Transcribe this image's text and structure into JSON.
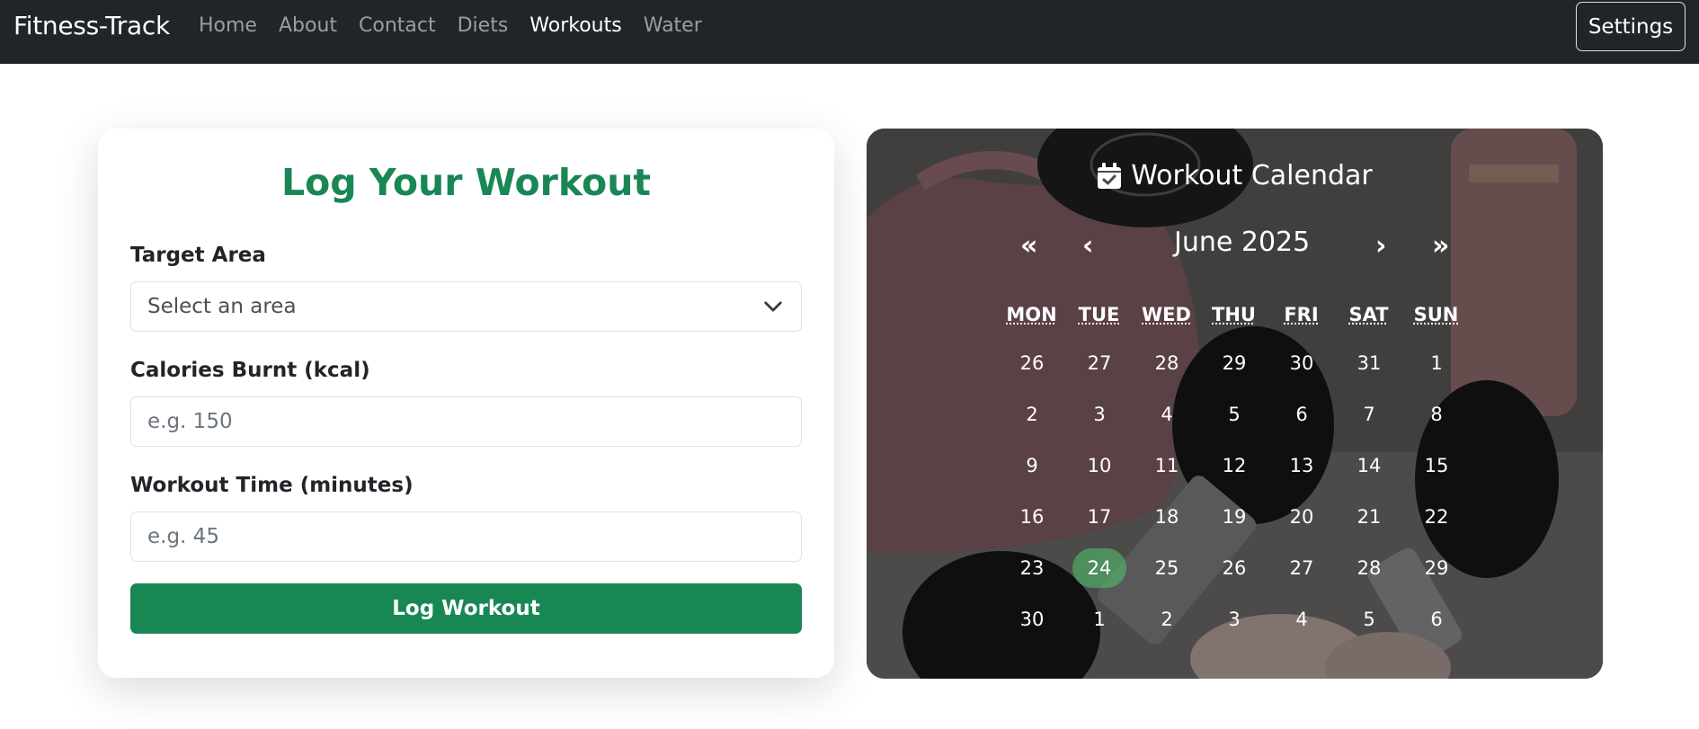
{
  "navbar": {
    "brand": "Fitness-Track",
    "links": [
      "Home",
      "About",
      "Contact",
      "Diets",
      "Workouts",
      "Water"
    ],
    "active_link": "Workouts",
    "settings_label": "Settings"
  },
  "form": {
    "title": "Log Your Workout",
    "target_area": {
      "label": "Target Area",
      "value": "Select an area"
    },
    "calories": {
      "label": "Calories Burnt (kcal)",
      "placeholder": "e.g. 150"
    },
    "time": {
      "label": "Workout Time (minutes)",
      "placeholder": "e.g. 45"
    },
    "submit_label": "Log Workout"
  },
  "calendar": {
    "title": "Workout Calendar",
    "month": "June 2025",
    "prev_year": "«",
    "prev_month": "‹",
    "next_month": "›",
    "next_year": "»",
    "weekdays": [
      "MON",
      "TUE",
      "WED",
      "THU",
      "FRI",
      "SAT",
      "SUN"
    ],
    "weeks": [
      [
        "26",
        "27",
        "28",
        "29",
        "30",
        "31",
        "1"
      ],
      [
        "2",
        "3",
        "4",
        "5",
        "6",
        "7",
        "8"
      ],
      [
        "9",
        "10",
        "11",
        "12",
        "13",
        "14",
        "15"
      ],
      [
        "16",
        "17",
        "18",
        "19",
        "20",
        "21",
        "22"
      ],
      [
        "23",
        "24",
        "25",
        "26",
        "27",
        "28",
        "29"
      ],
      [
        "30",
        "1",
        "2",
        "3",
        "4",
        "5",
        "6"
      ]
    ],
    "highlighted_day": "24"
  },
  "colors": {
    "primary": "#198754",
    "navbar_bg": "#212529"
  }
}
